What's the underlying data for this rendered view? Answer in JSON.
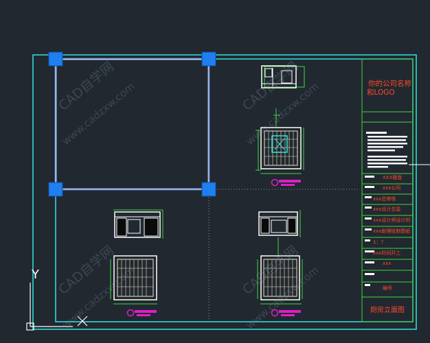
{
  "watermarks": [
    "CAD自学网",
    "www.cadzxw.com"
  ],
  "title_block": {
    "company": "你的公司名称",
    "company_logo": "和LOGO",
    "rows": [
      "XXX楼盘",
      "xxx公司",
      "xxx总审核",
      "xxx设计总监",
      "xxx设计师设计的",
      "xxx助理绘制图纸",
      "1：?",
      "xxx时间开工",
      "xxx",
      "编号"
    ],
    "drawing_title": "厨房立面图"
  },
  "ucs": {
    "y_label": "Y"
  },
  "colors": {
    "background": "#212830",
    "frame": "#2fe6e0",
    "green": "#3fd83f",
    "magenta": "#e01ec8",
    "orange_text": "#ff4a2a",
    "grip": "#1f7ff0",
    "selection": "#8fb2ff"
  }
}
